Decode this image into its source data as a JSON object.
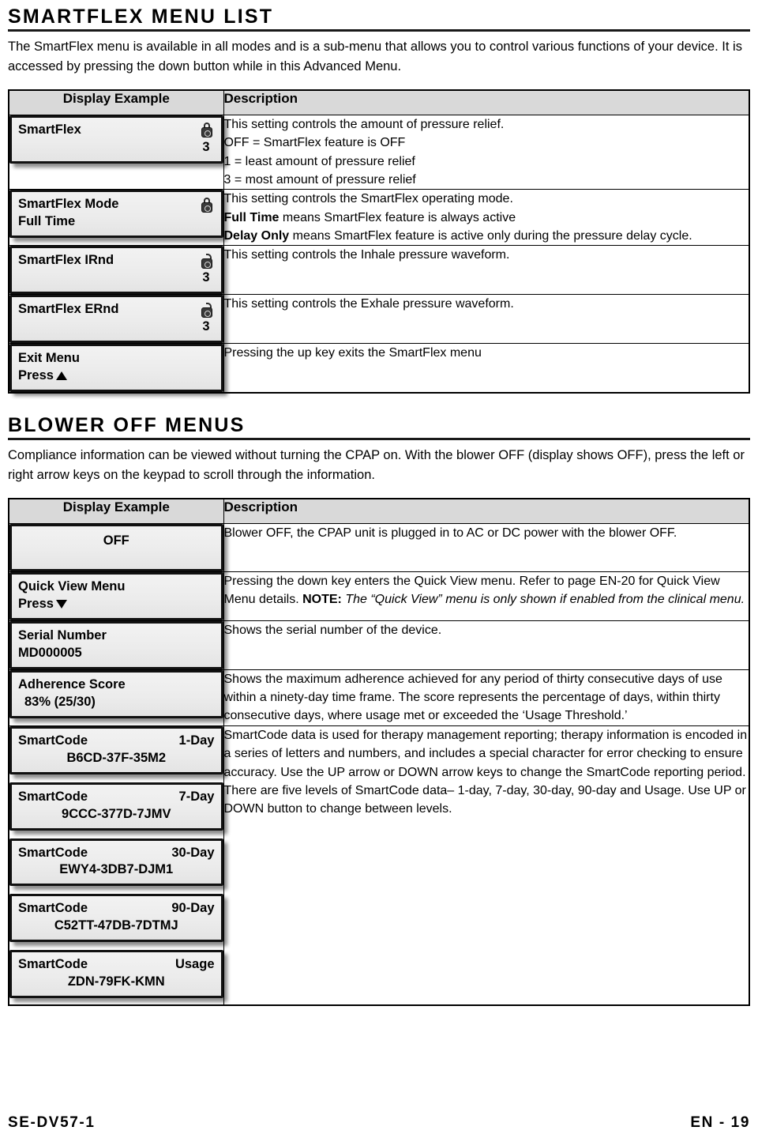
{
  "sections": [
    {
      "heading": "SMARTFLEX MENU LIST",
      "intro": "The SmartFlex menu is available in all modes and is a sub-menu that allows you to control various functions of your device. It is accessed by pressing the down button while in this Advanced Menu.",
      "columns": {
        "display": "Display Example",
        "description": "Description"
      }
    },
    {
      "heading": "BLOWER OFF MENUS",
      "intro": "Compliance information can be viewed without turning the CPAP on. With the blower OFF (display shows OFF), press the left or right arrow keys on the keypad to scroll through the information.",
      "columns": {
        "display": "Display Example",
        "description": "Description"
      }
    }
  ],
  "smartflex_rows": [
    {
      "lcd": {
        "label": "SmartFlex",
        "value": "3",
        "icon": "lock-closed-icon"
      },
      "desc": {
        "l1": "This setting controls the amount of pressure relief.",
        "l2": "OFF = SmartFlex feature is OFF",
        "l3": "1 = least amount of pressure relief",
        "l4": "3 =  most amount of pressure relief"
      }
    },
    {
      "lcd": {
        "label": "SmartFlex Mode",
        "value": "Full Time",
        "icon": "lock-closed-icon"
      },
      "desc": {
        "l1": "This setting controls the SmartFlex operating mode.",
        "l2_bold": "Full Time",
        "l2_rest": " means SmartFlex feature is always active",
        "l3_bold": "Delay Only",
        "l3_rest": " means SmartFlex feature is active only during the pressure delay cycle."
      }
    },
    {
      "lcd": {
        "label": "SmartFlex IRnd",
        "value": "3",
        "icon": "lock-open-icon"
      },
      "desc": {
        "l1": "This setting controls the Inhale pressure waveform."
      }
    },
    {
      "lcd": {
        "label": "SmartFlex ERnd",
        "value": "3",
        "icon": "lock-open-icon"
      },
      "desc": {
        "l1": "This setting controls the Exhale pressure waveform."
      }
    },
    {
      "lcd": {
        "label": "Exit Menu",
        "value": "Press",
        "icon": "none",
        "arrow": "up"
      },
      "desc": {
        "l1": "Pressing the up key exits the SmartFlex menu"
      }
    }
  ],
  "blower_rows": [
    {
      "lcd": {
        "centered_value": "OFF"
      },
      "desc": {
        "l1": "Blower OFF, the CPAP unit is plugged in to AC or DC power with the blower OFF."
      }
    },
    {
      "lcd": {
        "label": "Quick View Menu",
        "value": "Press",
        "arrow": "down"
      },
      "desc": {
        "p1": "Pressing the down key enters the Quick View menu. Refer to page EN-20 for Quick View Menu details. ",
        "note_label": "NOTE:",
        "note_italic": " The “Quick View” menu is only shown if enabled from the clinical menu."
      }
    },
    {
      "lcd": {
        "label": "Serial Number",
        "value": "MD000005"
      },
      "desc": {
        "l1": "Shows the serial number of the device."
      }
    },
    {
      "lcd": {
        "label": "Adherence Score",
        "value": "83% (25/30)"
      },
      "desc": {
        "l1": "Shows the maximum adherence achieved for any period of thirty consecutive days of use within a ninety-day time frame. The score represents the percentage of days, within thirty consecutive days, where usage met or exceeded the ‘Usage Threshold.’"
      }
    }
  ],
  "smartcode": {
    "codes": [
      {
        "label": "SmartCode",
        "period": "1-Day",
        "code": "B6CD-37F-35M2"
      },
      {
        "label": "SmartCode",
        "period": "7-Day",
        "code": "9CCC-377D-7JMV"
      },
      {
        "label": "SmartCode",
        "period": "30-Day",
        "code": "EWY4-3DB7-DJM1"
      },
      {
        "label": "SmartCode",
        "period": "90-Day",
        "code": "C52TT-47DB-7DTMJ"
      },
      {
        "label": "SmartCode",
        "period": "Usage",
        "code": "ZDN-79FK-KMN"
      }
    ],
    "desc": "SmartCode data is used for therapy management reporting; therapy information is encoded in a series of letters and numbers, and includes a special character for error checking to ensure accuracy. Use the UP arrow or DOWN arrow keys to change the SmartCode reporting period. There are five levels of SmartCode data– 1-day, 7-day, 30-day, 90-day and Usage. Use UP or DOWN button to change between levels."
  },
  "footer": {
    "left": "SE-DV57-1",
    "right": "EN - 19"
  }
}
